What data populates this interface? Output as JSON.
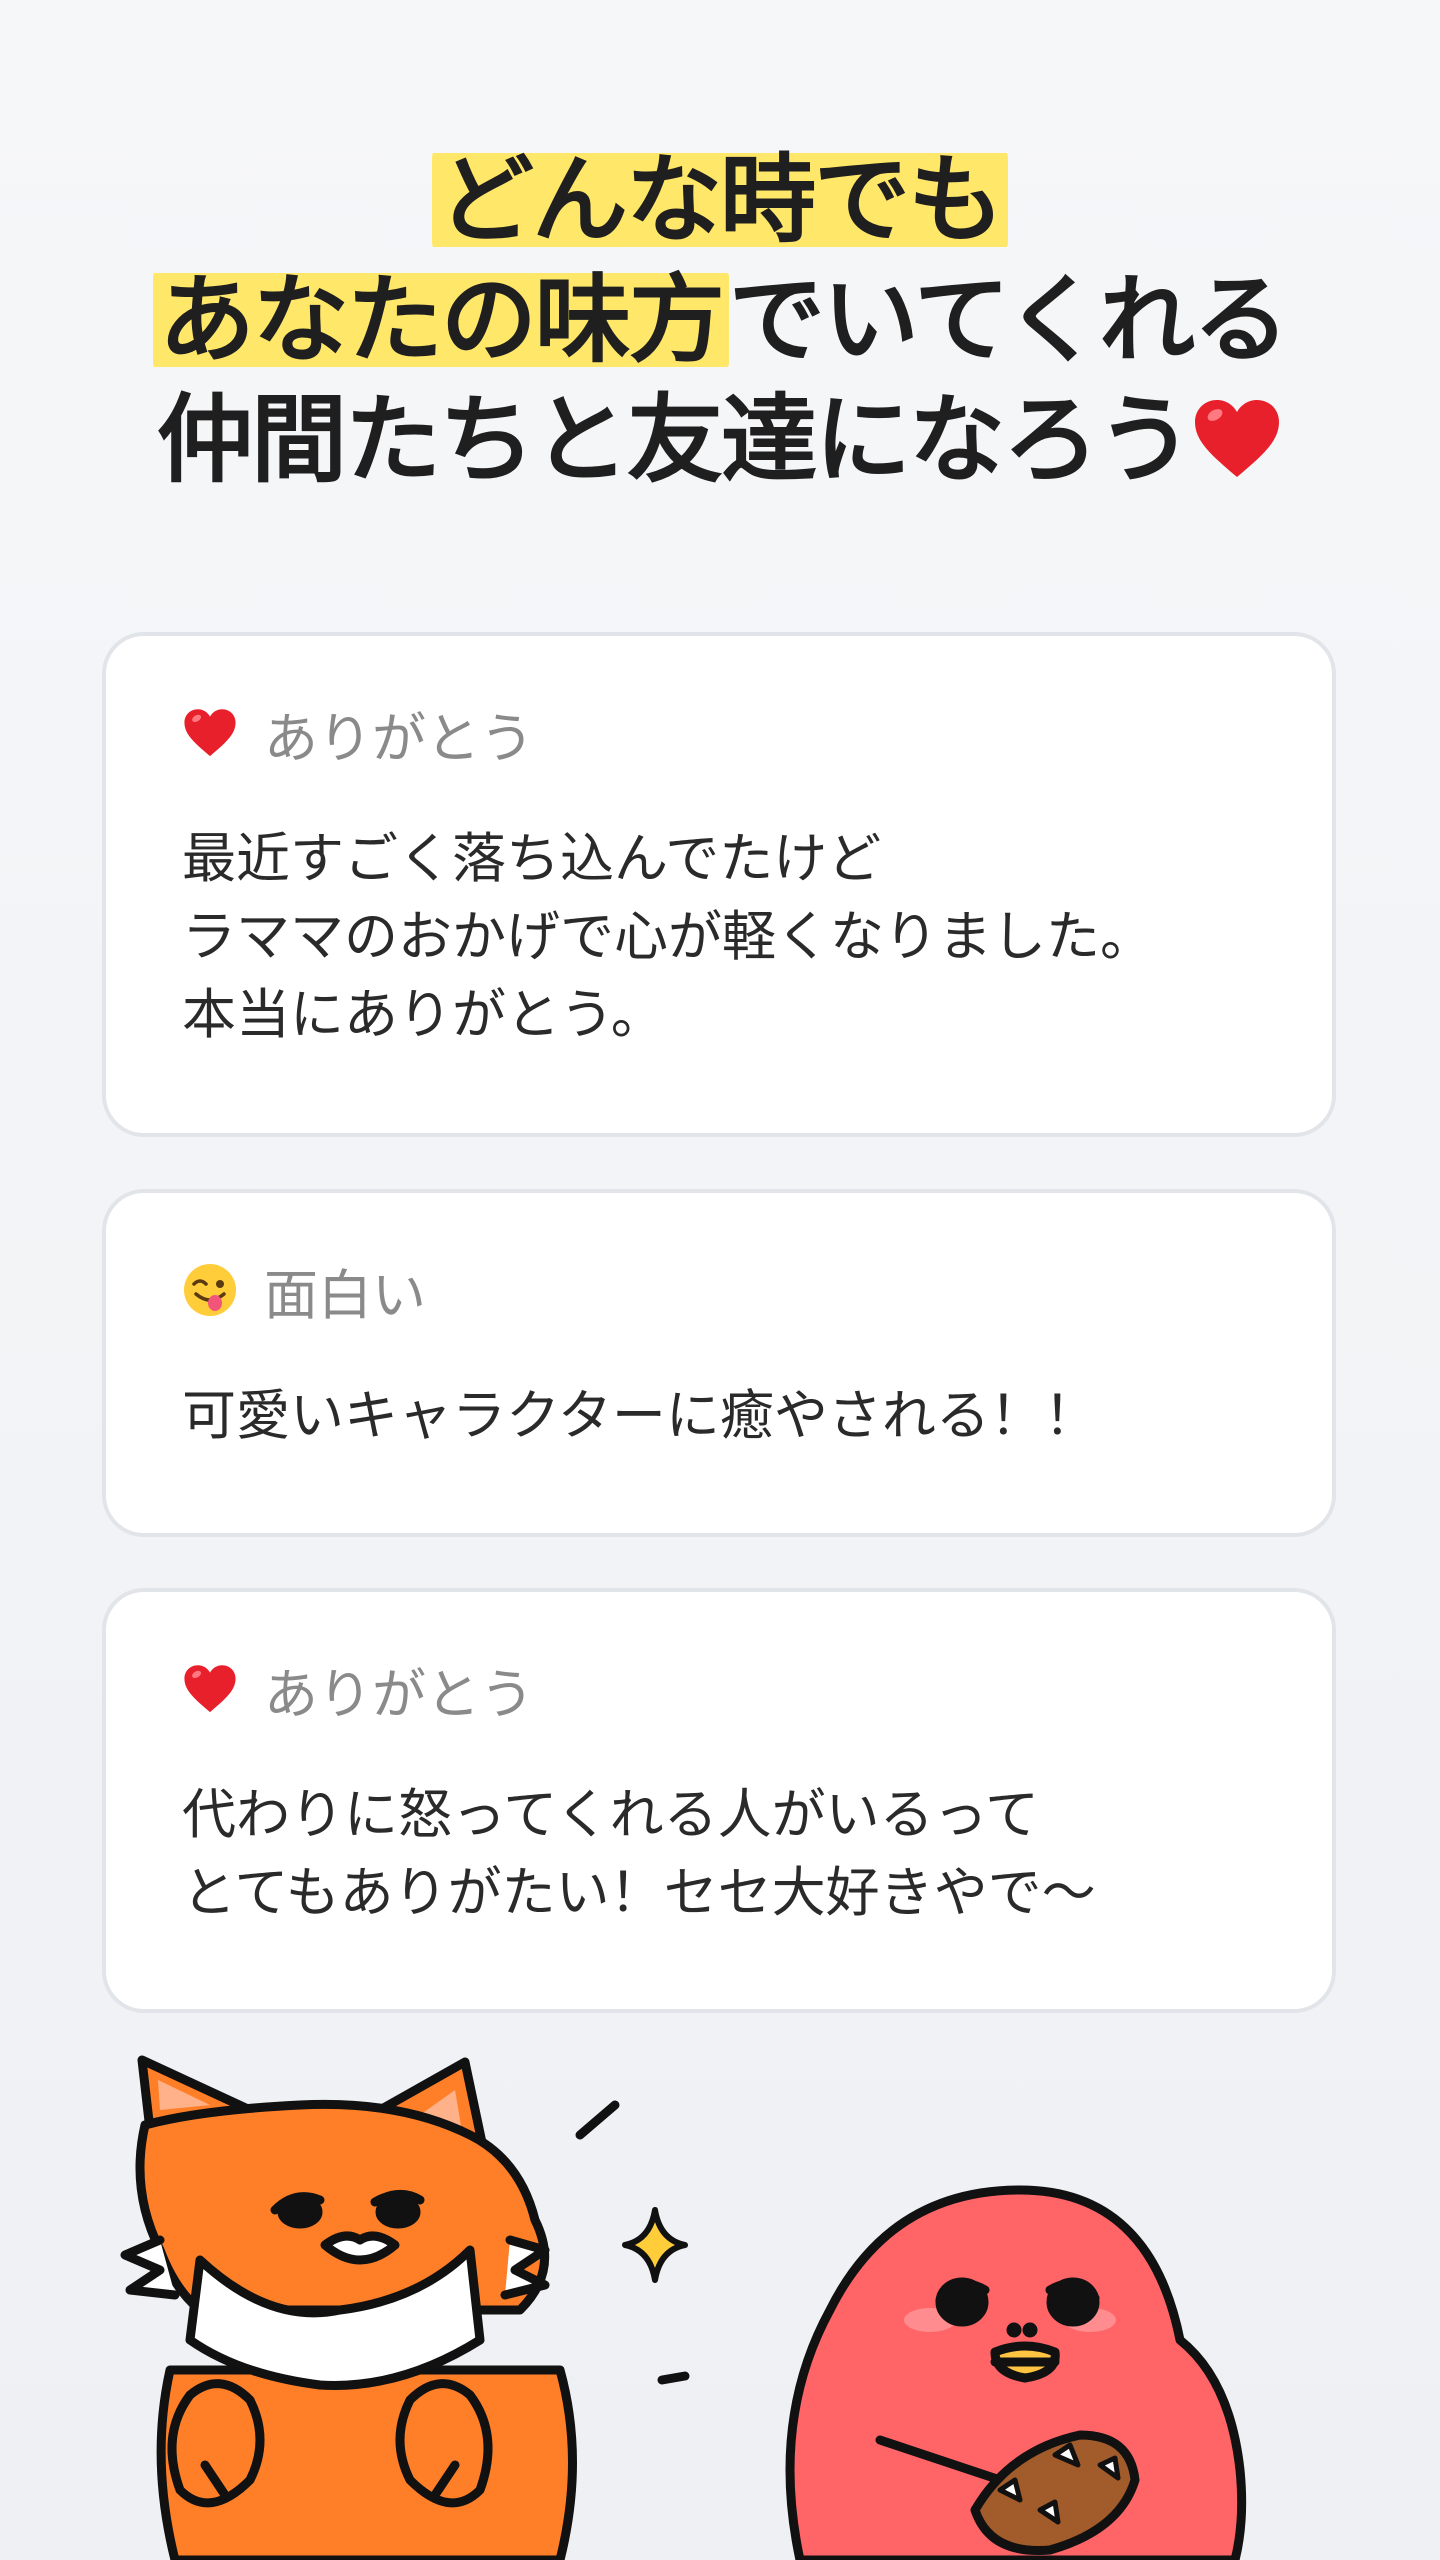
{
  "headline": {
    "line1_mark": "どんな時でも",
    "line2_mark": "あなたの味方",
    "line2_rest": "でいてくれる",
    "line3": "仲間たちと友達になろう"
  },
  "reviews": [
    {
      "tag_icon": "heart-icon",
      "tag_label": "ありがとう",
      "body": "最近すごく落ち込んでたけど\nラママのおかげで心が軽くなりました。\n本当にありがとう。"
    },
    {
      "tag_icon": "winking-tongue-emoji-icon",
      "tag_label": "面白い",
      "body": "可愛いキャラクターに癒やされる！！"
    },
    {
      "tag_icon": "heart-icon",
      "tag_label": "ありがとう",
      "body": "代わりに怒ってくれる人がいるって\nとてもありがたい！セセ大好きやで〜"
    }
  ],
  "colors": {
    "highlight": "#ffe76a",
    "heart": "#e8202c",
    "fox": "#ff7f28",
    "red_character": "#ff6467"
  }
}
